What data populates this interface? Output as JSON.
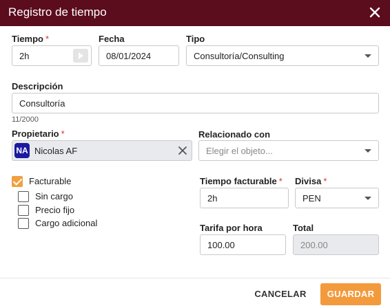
{
  "dialog": {
    "title": "Registro de tiempo",
    "close_icon": "close-icon"
  },
  "time": {
    "label": "Tiempo",
    "required_mark": "*",
    "value": "2h",
    "timer_icon": "play-icon"
  },
  "date": {
    "label": "Fecha",
    "value": "08/01/2024"
  },
  "type": {
    "label": "Tipo",
    "value": "Consultoría/Consulting"
  },
  "description": {
    "label": "Descripción",
    "value": "Consultoría",
    "counter": "11/2000"
  },
  "owner": {
    "label": "Propietario",
    "required_mark": "*",
    "avatar_initials": "NA",
    "name": "Nicolas AF",
    "clear_icon": "clear-icon"
  },
  "related": {
    "label": "Relacionado con",
    "placeholder": "Elegir el objeto..."
  },
  "checkboxes": {
    "billable": {
      "label": "Facturable",
      "checked": true
    },
    "no_charge": {
      "label": "Sin cargo",
      "checked": false
    },
    "fixed_price": {
      "label": "Precio fijo",
      "checked": false
    },
    "additional_charge": {
      "label": "Cargo adicional",
      "checked": false
    }
  },
  "billable_time": {
    "label": "Tiempo facturable",
    "required_mark": "*",
    "value": "2h"
  },
  "currency": {
    "label": "Divisa",
    "required_mark": "*",
    "value": "PEN"
  },
  "hourly_rate": {
    "label": "Tarifa por hora",
    "value": "100.00"
  },
  "total": {
    "label": "Total",
    "value": "200.00"
  },
  "footer": {
    "cancel_label": "CANCELAR",
    "save_label": "GUARDAR"
  },
  "colors": {
    "header_bg": "#5b0c1d",
    "accent": "#f39a3c",
    "required": "#d9302c",
    "avatar_bg": "#1a1aa0"
  }
}
